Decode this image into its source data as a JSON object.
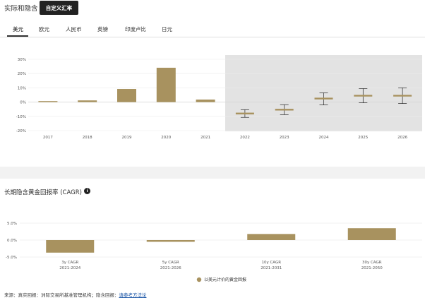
{
  "header": {
    "title": "实际和隐含",
    "custom_button": "自定义汇率"
  },
  "tabs": [
    {
      "label": "美元",
      "active": true
    },
    {
      "label": "欧元"
    },
    {
      "label": "人民币"
    },
    {
      "label": "英镑"
    },
    {
      "label": "印度卢比"
    },
    {
      "label": "日元"
    }
  ],
  "chart_data": [
    {
      "type": "bar",
      "title": "",
      "categories": [
        "2017",
        "2018",
        "2019",
        "2020",
        "2021",
        "2022",
        "2023",
        "2024",
        "2025",
        "2026"
      ],
      "actual_values": [
        0.7,
        1.2,
        9.2,
        24.1,
        1.8,
        null,
        null,
        null,
        null,
        null
      ],
      "implied": [
        {
          "year": "2022",
          "value": -8.0,
          "low": -10.7,
          "high": -5.3
        },
        {
          "year": "2023",
          "value": -5.3,
          "low": -8.8,
          "high": -1.8
        },
        {
          "year": "2024",
          "value": 2.5,
          "low": -2.0,
          "high": 6.5
        },
        {
          "year": "2025",
          "value": 4.5,
          "low": -0.5,
          "high": 9.5
        },
        {
          "year": "2026",
          "value": 4.5,
          "low": -1.0,
          "high": 10.0
        }
      ],
      "implied_shading": true,
      "y_ticks": [
        "30%",
        "20%",
        "10%",
        "0%",
        "-10%",
        "-20%"
      ],
      "ylim": [
        -20,
        30
      ],
      "bar_color": "#a8925f"
    },
    {
      "type": "bar",
      "title": "长期隐含黄金回报率 (CAGR)",
      "categories": [
        {
          "label": "3y CAGR",
          "range": "2021-2024"
        },
        {
          "label": "5y CAGR",
          "range": "2021-2026"
        },
        {
          "label": "10y CAGR",
          "range": "2021-2031"
        },
        {
          "label": "30y CAGR",
          "range": "2021-2050"
        }
      ],
      "values": [
        -3.7,
        -0.5,
        1.8,
        3.5
      ],
      "y_ticks": [
        "5.0%",
        "0.0%",
        "-5.0%"
      ],
      "ylim": [
        -5,
        5
      ],
      "legend": "以美元计价的黄金回报",
      "bar_color": "#a8925f"
    }
  ],
  "footnote": {
    "text": "来源：真实回报：洲际交易所基准管理机构；隐含回报：",
    "link": "请参考方法论"
  }
}
